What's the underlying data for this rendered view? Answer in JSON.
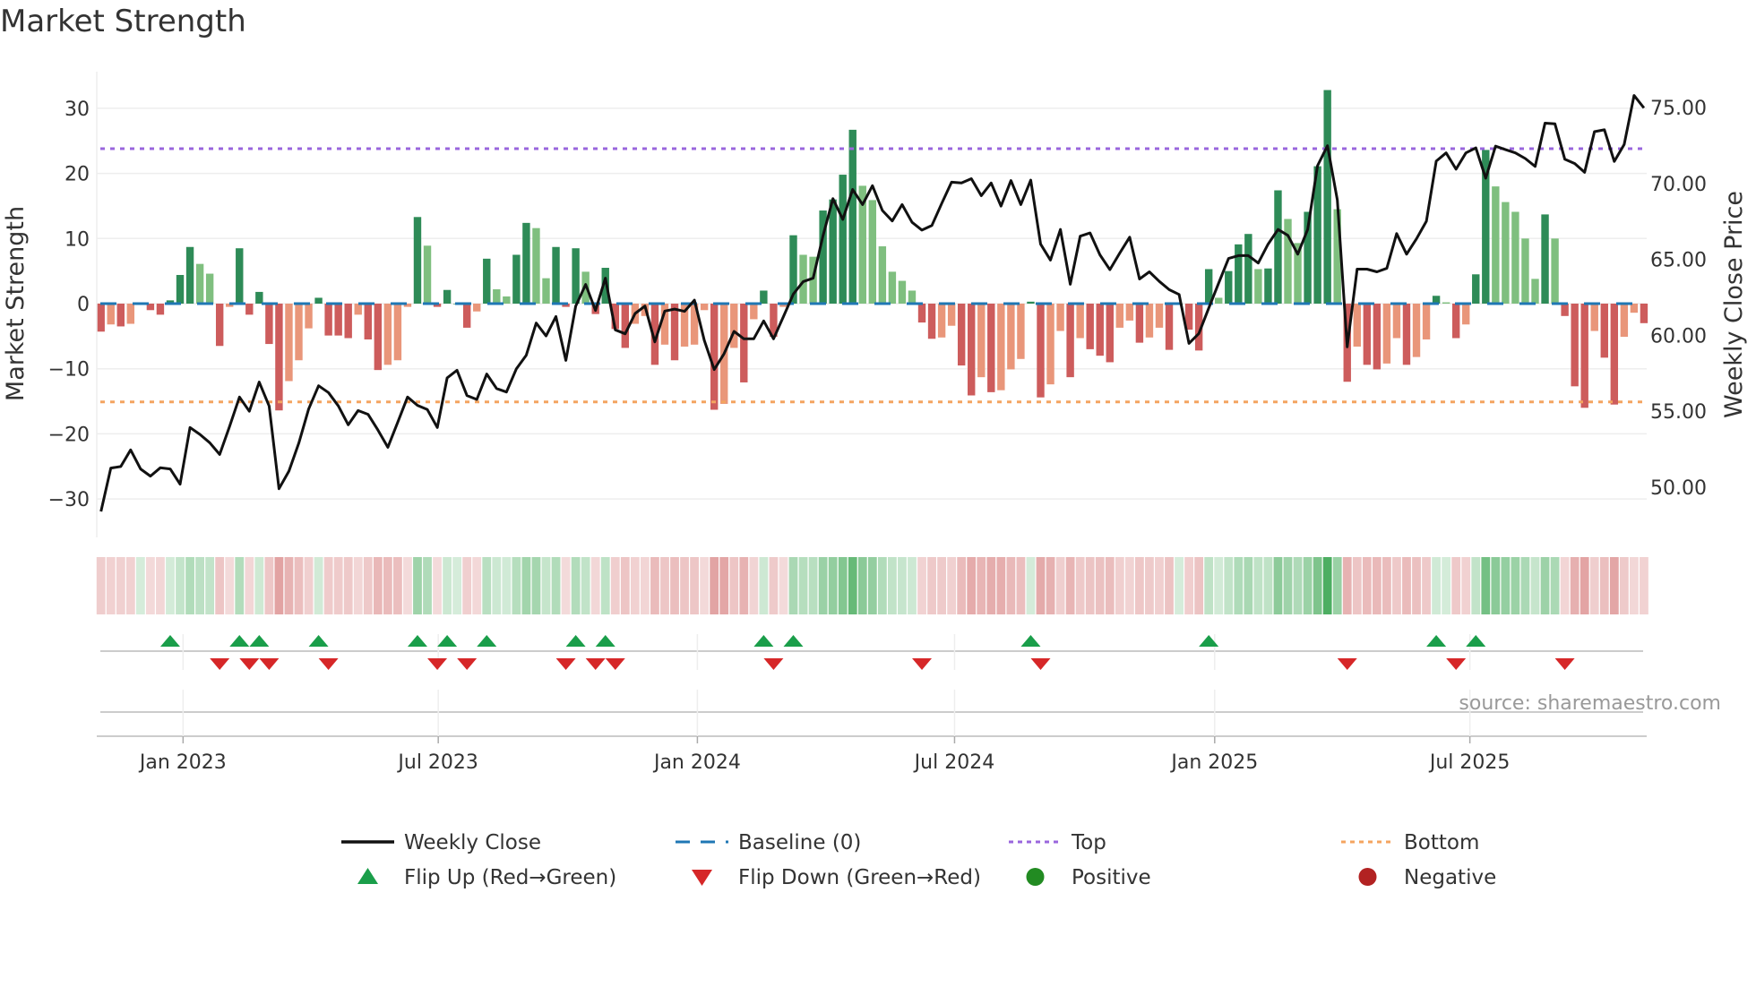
{
  "chart_data": {
    "type": "bar",
    "title": "Market Strength",
    "ylabel": "Market Strength",
    "y2label": "Weekly Close Price",
    "ylim": [
      -35,
      35
    ],
    "y2lim": [
      47.3,
      78.2
    ],
    "yticks": [
      "30",
      "20",
      "10",
      "0",
      "−10",
      "−20",
      "−30"
    ],
    "ytick_values": [
      30,
      20,
      10,
      0,
      -10,
      -20,
      -30
    ],
    "y2ticks": [
      "75.00",
      "70.00",
      "65.00",
      "60.00",
      "55.00",
      "50.00"
    ],
    "y2tick_values": [
      75,
      70,
      65,
      60,
      55,
      50
    ],
    "xticks": [
      {
        "label": "Jan 2023",
        "week": 8.3
      },
      {
        "label": "Jul 2023",
        "week": 34.1
      },
      {
        "label": "Jan 2024",
        "week": 60.3
      },
      {
        "label": "Jul 2024",
        "week": 86.3
      },
      {
        "label": "Jan 2025",
        "week": 112.6
      },
      {
        "label": "Jul 2025",
        "week": 138.4
      }
    ],
    "top_level": 23.8,
    "bottom_level": -15.1,
    "baseline": 0,
    "strength": [
      -4.3,
      -3.2,
      -3.5,
      -3.1,
      0,
      -1.0,
      -1.7,
      0.5,
      4.4,
      8.7,
      6.1,
      4.6,
      -6.5,
      -0.5,
      8.5,
      -1.7,
      1.8,
      -6.2,
      -16.4,
      -11.9,
      -8.7,
      -3.8,
      0.9,
      -4.9,
      -4.9,
      -5.3,
      -1.7,
      -5.5,
      -10.2,
      -9.4,
      -8.7,
      -0.5,
      13.3,
      8.9,
      -0.5,
      2.1,
      0,
      -3.7,
      -1.2,
      6.9,
      2.2,
      1.1,
      7.5,
      12.4,
      11.6,
      3.9,
      8.7,
      -0.5,
      8.5,
      4.9,
      -1.6,
      5.5,
      -3.9,
      -6.8,
      -3.1,
      -1.9,
      -9.4,
      -6.3,
      -8.7,
      -6.6,
      -6.3,
      -1.0,
      -16.3,
      -15.4,
      -6.8,
      -12.1,
      -2.4,
      2.0,
      -5.1,
      -0.5,
      10.5,
      7.5,
      7.2,
      14.3,
      16.0,
      19.8,
      26.7,
      18.1,
      15.9,
      8.8,
      4.9,
      3.5,
      2.0,
      -2.9,
      -5.4,
      -5.2,
      -3.4,
      -9.5,
      -14.1,
      -11.3,
      -13.6,
      -13.3,
      -10.1,
      -8.5,
      0.3,
      -14.4,
      -12.4,
      -4.2,
      -11.3,
      -5.3,
      -7.0,
      -8.0,
      -9.0,
      -3.7,
      -2.6,
      -6.0,
      -5.2,
      -3.7,
      -7.1,
      0,
      -4.0,
      -7.2,
      5.3,
      0.9,
      5.0,
      9.1,
      10.7,
      5.3,
      5.4,
      17.4,
      13.0,
      9.3,
      14.1,
      21.1,
      32.8,
      14.5,
      -12.0,
      -6.6,
      -9.4,
      -10.1,
      -9.2,
      -5.3,
      -9.4,
      -8.2,
      -5.5,
      1.2,
      0.2,
      -5.3,
      -3.2,
      4.5,
      23.6,
      18.0,
      15.6,
      14.1,
      10.0,
      3.8,
      13.7,
      10.0,
      -1.9,
      -12.7,
      -16.0,
      -4.2,
      -8.3,
      -15.5,
      -5.1,
      -1.4,
      -3.0
    ],
    "weekly_close": [
      48.4,
      51.26,
      51.36,
      52.46,
      51.2,
      50.73,
      51.28,
      51.2,
      50.2,
      53.93,
      53.48,
      52.93,
      52.16,
      54.0,
      55.94,
      55.0,
      56.92,
      55.35,
      49.9,
      51.06,
      52.9,
      55.15,
      56.68,
      56.23,
      55.35,
      54.11,
      55.05,
      54.8,
      53.77,
      52.63,
      54.27,
      55.94,
      55.39,
      55.11,
      53.93,
      57.2,
      57.7,
      56.04,
      55.78,
      57.45,
      56.5,
      56.27,
      57.8,
      58.69,
      60.81,
      59.96,
      61.24,
      58.35,
      61.93,
      63.35,
      61.64,
      63.76,
      60.36,
      60.1,
      61.44,
      61.93,
      59.57,
      61.6,
      61.73,
      61.58,
      62.32,
      59.67,
      57.75,
      58.79,
      60.26,
      59.77,
      59.77,
      60.95,
      59.77,
      61.24,
      62.72,
      63.54,
      63.76,
      66.55,
      69.0,
      67.63,
      69.6,
      68.61,
      69.85,
      68.22,
      67.53,
      68.61,
      67.44,
      66.93,
      67.23,
      68.68,
      70.08,
      70.03,
      70.31,
      69.19,
      70.03,
      68.51,
      70.19,
      68.61,
      70.22,
      66.0,
      64.95,
      66.97,
      63.36,
      66.53,
      66.74,
      65.3,
      64.32,
      65.41,
      66.46,
      63.71,
      64.18,
      63.55,
      63.01,
      62.69,
      59.47,
      60.12,
      61.8,
      63.43,
      65.06,
      65.25,
      65.25,
      64.76,
      66.0,
      66.97,
      66.58,
      65.34,
      66.97,
      71.17,
      72.48,
      68.91,
      59.24,
      64.36,
      64.36,
      64.18,
      64.41,
      66.7,
      65.34,
      66.35,
      67.51,
      71.47,
      72.01,
      70.94,
      72.01,
      72.34,
      70.35,
      72.45,
      72.22,
      72.01,
      71.64,
      71.12,
      73.97,
      73.92,
      71.59,
      71.31,
      70.73,
      73.41,
      73.53,
      71.45,
      72.57,
      75.79,
      74.97
    ],
    "flip_up_weeks": [
      7,
      14,
      16,
      22,
      32,
      35,
      39,
      48,
      51,
      67,
      70,
      94,
      112,
      135,
      139
    ],
    "flip_down_weeks": [
      12,
      15,
      17,
      23,
      34,
      37,
      47,
      50,
      52,
      68,
      83,
      95,
      126,
      137,
      148
    ],
    "legend": {
      "placement": "bottom",
      "items": [
        {
          "label": "Weekly Close",
          "kind": "line"
        },
        {
          "label": "Baseline (0)",
          "kind": "dash"
        },
        {
          "label": "Top",
          "kind": "dot-purple"
        },
        {
          "label": "Bottom",
          "kind": "dot-orange"
        },
        {
          "label": "Flip Up (Red→Green)",
          "kind": "tri-up"
        },
        {
          "label": "Flip Down (Green→Red)",
          "kind": "tri-down"
        },
        {
          "label": "Positive",
          "kind": "circle-green"
        },
        {
          "label": "Negative",
          "kind": "circle-red"
        }
      ]
    },
    "grid": true
  },
  "source": "source: sharemaestro.com",
  "colors": {
    "pos_strong": "#2e8b57",
    "pos_weak": "#7fbf7f",
    "neg_strong": "#cd5c5c",
    "neg_weak": "#e9967a",
    "baseline": "#1f77b4",
    "top": "#9966dd",
    "bottom": "#f4a460",
    "line": "#111111",
    "flip_up": "#1a9e4a",
    "flip_down": "#d62728",
    "positive": "#228b22",
    "negative": "#b22222"
  }
}
